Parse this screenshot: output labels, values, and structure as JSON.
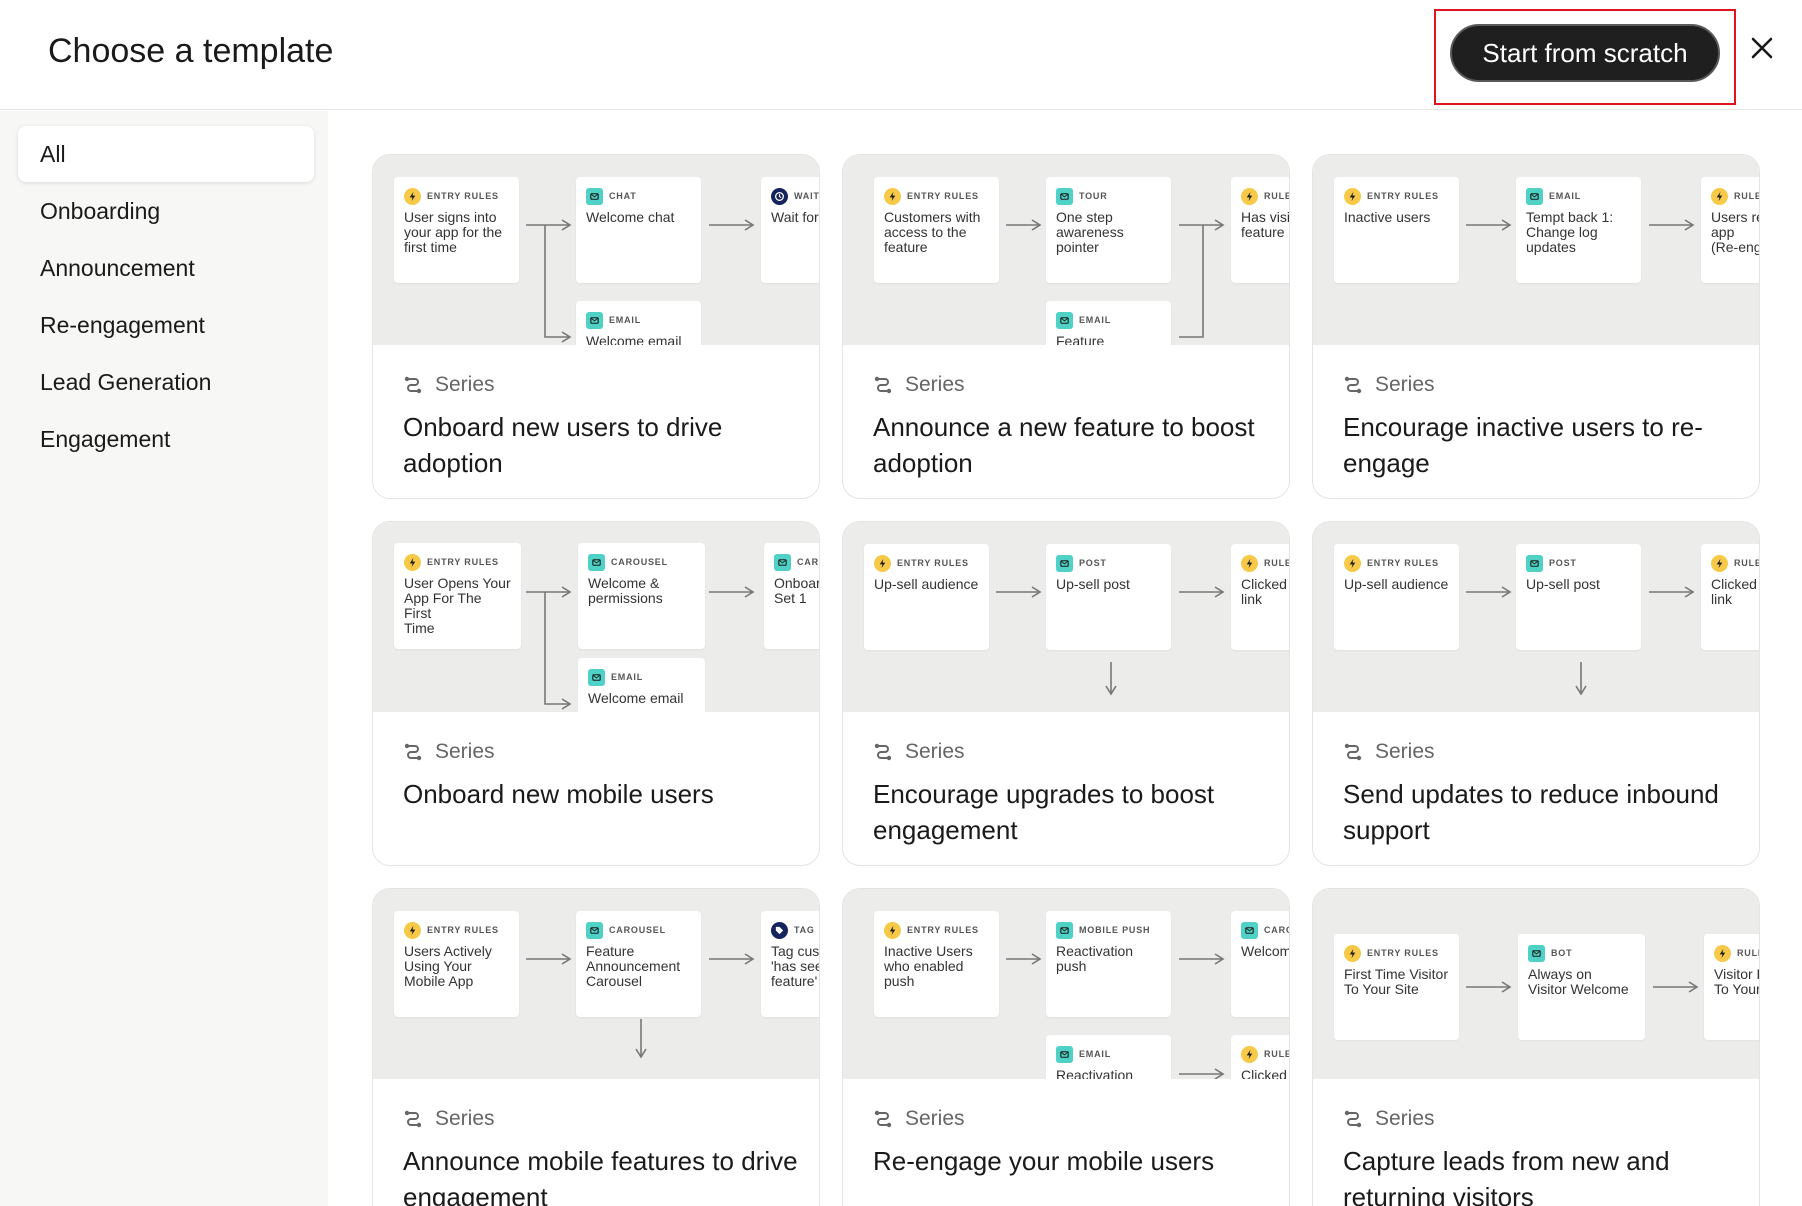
{
  "header": {
    "title": "Choose a template",
    "cta_label": "Start from scratch"
  },
  "sidebar": {
    "items": [
      {
        "label": "All",
        "active": true
      },
      {
        "label": "Onboarding"
      },
      {
        "label": "Announcement"
      },
      {
        "label": "Re-engagement"
      },
      {
        "label": "Lead Generation"
      },
      {
        "label": "Engagement"
      }
    ]
  },
  "colors": {
    "accent_dark": "#1f1f1f",
    "highlight_red": "#e0141e",
    "rules_yellow": "#f7c948",
    "teal": "#4fd1c5",
    "sidebar_bg": "#f7f7f6",
    "preview_bg": "#ececeb"
  },
  "cards": [
    {
      "type": "Series",
      "title": "Onboard new users to drive adoption",
      "nodes": [
        {
          "label": "ENTRY RULES",
          "text": "User signs into\nyour app for the\nfirst time",
          "icon": "lightning-icon"
        },
        {
          "label": "CHAT",
          "text": "Welcome chat",
          "icon": "chat-icon"
        },
        {
          "label": "WAIT",
          "text": "Wait for",
          "icon": "clock-icon"
        },
        {
          "label": "EMAIL",
          "text": "Welcome email",
          "icon": "email-icon"
        }
      ]
    },
    {
      "type": "Series",
      "title": "Announce a new feature to boost adoption",
      "nodes": [
        {
          "label": "ENTRY RULES",
          "text": "Customers with\naccess to the\nfeature",
          "icon": "lightning-icon"
        },
        {
          "label": "TOUR",
          "text": "One step\nawareness\npointer",
          "icon": "tour-icon"
        },
        {
          "label": "RULE",
          "text": "Has visi\nfeature",
          "icon": "lightning-icon"
        },
        {
          "label": "EMAIL",
          "text": "Feature",
          "icon": "email-icon"
        }
      ]
    },
    {
      "type": "Series",
      "title": "Encourage inactive users to re-engage",
      "nodes": [
        {
          "label": "ENTRY RULES",
          "text": "Inactive users",
          "icon": "lightning-icon"
        },
        {
          "label": "EMAIL",
          "text": "Tempt back 1:\nChange log\nupdates",
          "icon": "email-icon"
        },
        {
          "label": "RULE",
          "text": "Users re\napp\n(Re-eng",
          "icon": "lightning-icon"
        }
      ]
    },
    {
      "type": "Series",
      "title": "Onboard new mobile users",
      "nodes": [
        {
          "label": "ENTRY RULES",
          "text": "User Opens Your\nApp For The First\nTime",
          "icon": "lightning-icon"
        },
        {
          "label": "CAROUSEL",
          "text": "Welcome &\npermissions",
          "icon": "carousel-icon"
        },
        {
          "label": "CAR",
          "text": "Onboar\nSet 1",
          "icon": "carousel-icon"
        },
        {
          "label": "EMAIL",
          "text": "Welcome email",
          "icon": "email-icon"
        }
      ]
    },
    {
      "type": "Series",
      "title": "Encourage upgrades to boost engagement",
      "nodes": [
        {
          "label": "ENTRY RULES",
          "text": "Up-sell audience",
          "icon": "lightning-icon"
        },
        {
          "label": "POST",
          "text": "Up-sell post",
          "icon": "post-icon"
        },
        {
          "label": "RULE",
          "text": "Clicked\nlink",
          "icon": "lightning-icon"
        }
      ]
    },
    {
      "type": "Series",
      "title": "Send updates to reduce inbound support",
      "nodes": [
        {
          "label": "ENTRY RULES",
          "text": "Up-sell audience",
          "icon": "lightning-icon"
        },
        {
          "label": "POST",
          "text": "Up-sell post",
          "icon": "post-icon"
        },
        {
          "label": "RULE",
          "text": "Clicked\nlink",
          "icon": "lightning-icon"
        }
      ]
    },
    {
      "type": "Series",
      "title": "Announce mobile features to drive engagement",
      "nodes": [
        {
          "label": "ENTRY RULES",
          "text": "Users Actively\nUsing Your\nMobile App",
          "icon": "lightning-icon"
        },
        {
          "label": "CAROUSEL",
          "text": "Feature\nAnnouncement\nCarousel",
          "icon": "carousel-icon"
        },
        {
          "label": "TAG",
          "text": "Tag cus\n'has see\nfeature'",
          "icon": "tag-icon"
        }
      ]
    },
    {
      "type": "Series",
      "title": "Re-engage your mobile users",
      "nodes": [
        {
          "label": "ENTRY RULES",
          "text": "Inactive Users\nwho enabled\npush",
          "icon": "lightning-icon"
        },
        {
          "label": "MOBILE PUSH",
          "text": "Reactivation\npush",
          "icon": "mobile-icon"
        },
        {
          "label": "CARO",
          "text": "Welcom",
          "icon": "carousel-icon"
        },
        {
          "label": "EMAIL",
          "text": "Reactivation",
          "icon": "email-icon"
        },
        {
          "label": "RULE",
          "text": "Clicked",
          "icon": "lightning-icon"
        }
      ]
    },
    {
      "type": "Series",
      "title": "Capture leads from new and returning visitors",
      "nodes": [
        {
          "label": "ENTRY RULES",
          "text": "First Time Visitor\nTo Your Site",
          "icon": "lightning-icon"
        },
        {
          "label": "BOT",
          "text": "Always on\nVisitor Welcome",
          "icon": "bot-icon"
        },
        {
          "label": "RULE",
          "text": "Visitor F\nTo Your",
          "icon": "lightning-icon"
        }
      ]
    }
  ]
}
